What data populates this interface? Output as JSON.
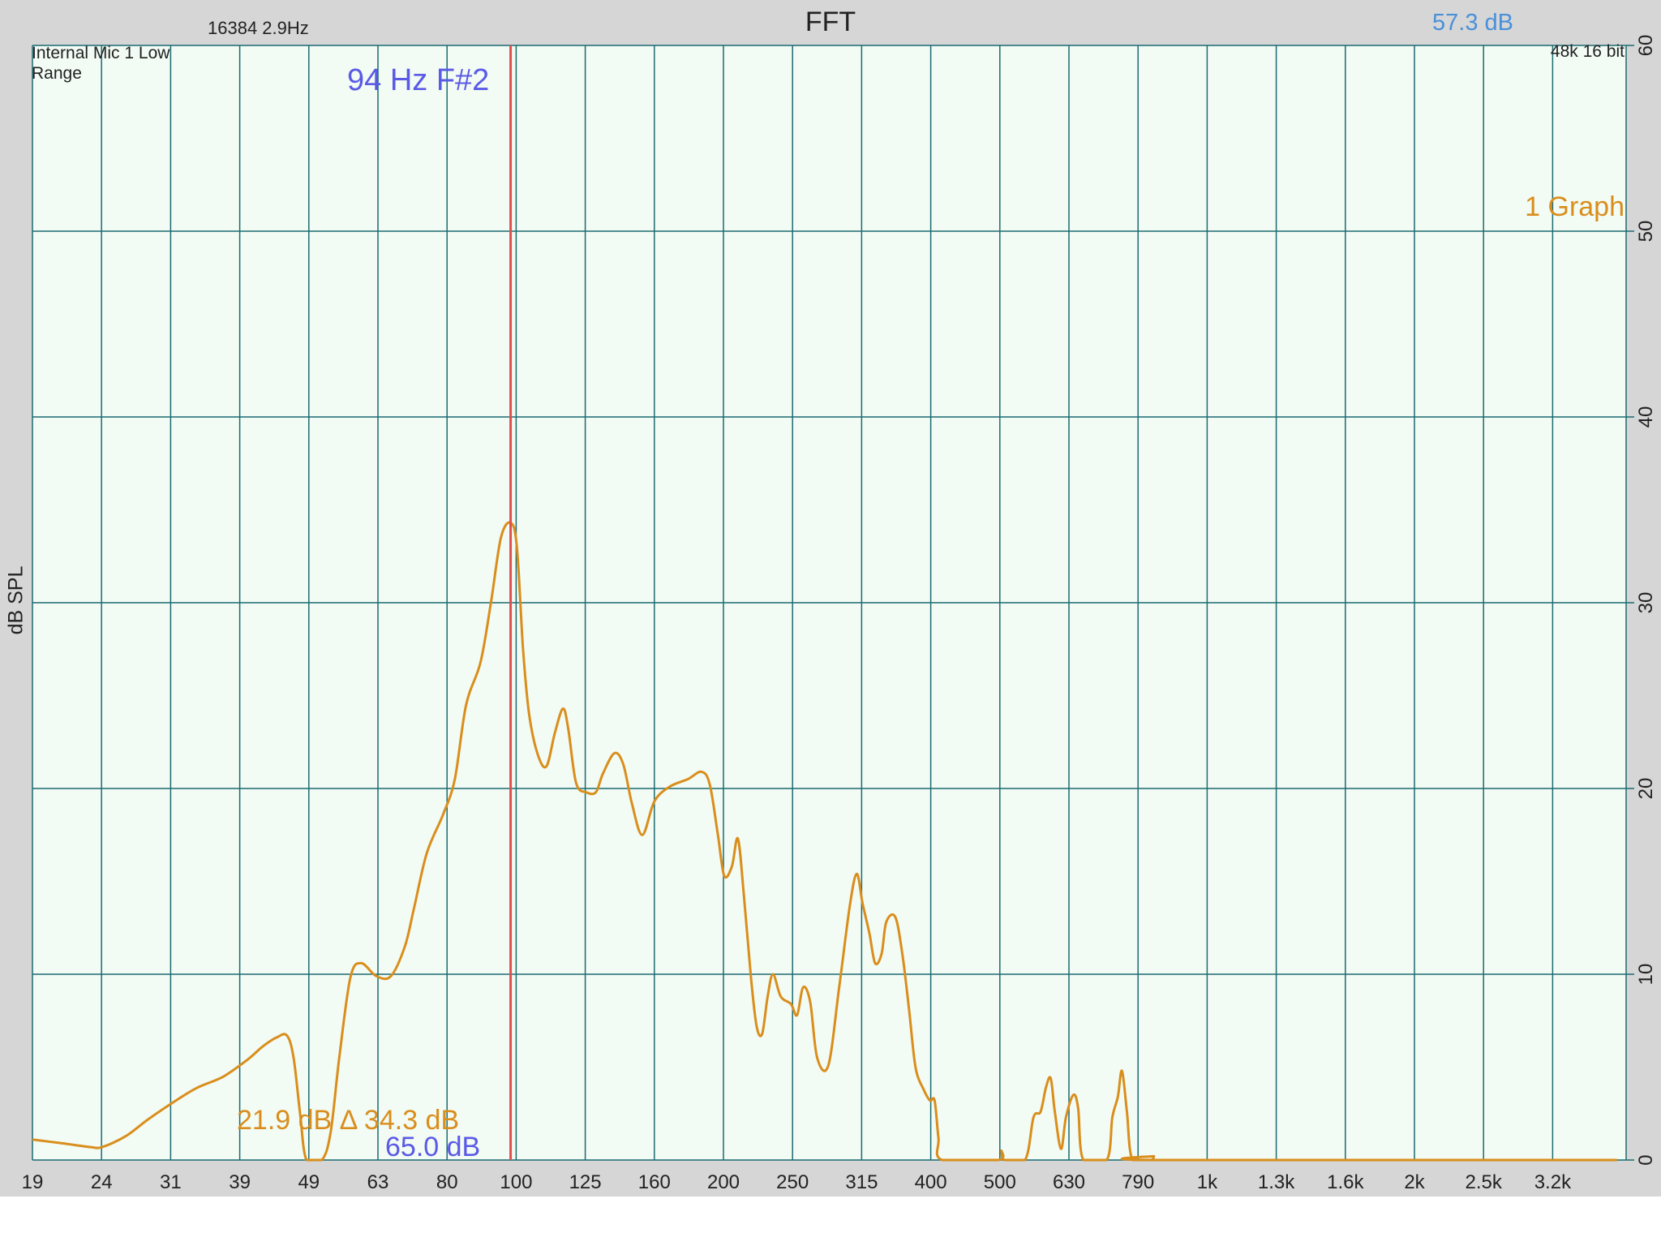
{
  "header": {
    "title": "FFT",
    "fft_info": "16384  2.9Hz",
    "level_readout": "57.3 dB"
  },
  "overlay": {
    "input_label": "Internal Mic 1 Low Range",
    "format_label": "48k 16 bit",
    "graph_label": "1 Graph",
    "marker_note": "94 Hz F#2",
    "marker_level": "21.9 dB Δ 34.3 dB",
    "marker_ref": "65.0 dB"
  },
  "colors": {
    "frame": "#d6d6d6",
    "plot_background": "#f2fbf4",
    "gridline": "#1b6b72",
    "curve": "#d98e1c",
    "marker": "#e05050",
    "note_text": "#5a5ae6",
    "level_text": "#4a90d9"
  },
  "chart_data": {
    "type": "line",
    "title": "FFT",
    "xlabel": "",
    "ylabel": "dB SPL",
    "x_scale": "log",
    "x_ticks": [
      "19",
      "24",
      "31",
      "39",
      "49",
      "63",
      "80",
      "100",
      "125",
      "160",
      "200",
      "250",
      "315",
      "400",
      "500",
      "630",
      "790",
      "1k",
      "1.3k",
      "1.6k",
      "2k",
      "2.5k",
      "3.2k"
    ],
    "y_ticks": [
      "0",
      "10",
      "20",
      "30",
      "40",
      "50",
      "60"
    ],
    "ylim": [
      0,
      60
    ],
    "grid": true,
    "marker_frequency_hz": 94,
    "series": [
      {
        "name": "1 Graph",
        "points": [
          [
            19,
            1.1
          ],
          [
            21,
            0.9
          ],
          [
            23,
            0.7
          ],
          [
            24,
            0.7
          ],
          [
            26,
            1.3
          ],
          [
            28,
            2.2
          ],
          [
            31,
            3.3
          ],
          [
            33,
            3.9
          ],
          [
            36,
            4.5
          ],
          [
            39,
            5.4
          ],
          [
            41,
            6.1
          ],
          [
            43,
            6.6
          ],
          [
            44.5,
            6.7
          ],
          [
            45.5,
            5.5
          ],
          [
            46.5,
            2.5
          ],
          [
            47.5,
            0
          ],
          [
            50,
            0
          ],
          [
            51.5,
            1.5
          ],
          [
            53,
            5.5
          ],
          [
            55,
            9.8
          ],
          [
            57,
            10.6
          ],
          [
            60,
            9.9
          ],
          [
            63,
            9.9
          ],
          [
            66,
            11.5
          ],
          [
            68,
            13.5
          ],
          [
            71,
            16.5
          ],
          [
            75,
            18.6
          ],
          [
            78,
            20.5
          ],
          [
            81,
            24.5
          ],
          [
            85,
            26.8
          ],
          [
            88,
            30.0
          ],
          [
            91,
            33.5
          ],
          [
            94,
            34.3
          ],
          [
            96,
            33.0
          ],
          [
            98,
            27.5
          ],
          [
            100,
            24.0
          ],
          [
            103,
            21.8
          ],
          [
            106,
            21.2
          ],
          [
            109,
            23.0
          ],
          [
            112,
            24.3
          ],
          [
            114,
            23.2
          ],
          [
            117,
            20.3
          ],
          [
            121,
            19.8
          ],
          [
            125,
            19.8
          ],
          [
            128,
            20.8
          ],
          [
            133,
            21.9
          ],
          [
            137,
            21.3
          ],
          [
            141,
            19.2
          ],
          [
            146,
            17.5
          ],
          [
            152,
            19.3
          ],
          [
            160,
            20.1
          ],
          [
            170,
            20.5
          ],
          [
            178,
            20.9
          ],
          [
            183,
            20.2
          ],
          [
            188,
            17.5
          ],
          [
            192,
            15.3
          ],
          [
            197,
            15.8
          ],
          [
            201,
            17.3
          ],
          [
            205,
            14.3
          ],
          [
            210,
            9.8
          ],
          [
            214,
            7.2
          ],
          [
            218,
            6.8
          ],
          [
            222,
            8.8
          ],
          [
            226,
            10.0
          ],
          [
            232,
            8.8
          ],
          [
            240,
            8.4
          ],
          [
            245,
            7.8
          ],
          [
            250,
            9.3
          ],
          [
            256,
            8.5
          ],
          [
            262,
            5.5
          ],
          [
            272,
            5.1
          ],
          [
            282,
            9.3
          ],
          [
            292,
            13.6
          ],
          [
            299,
            15.4
          ],
          [
            305,
            13.8
          ],
          [
            312,
            12.2
          ],
          [
            318,
            10.6
          ],
          [
            325,
            11.1
          ],
          [
            330,
            12.8
          ],
          [
            340,
            13.1
          ],
          [
            348,
            11.2
          ],
          [
            356,
            8.2
          ],
          [
            364,
            5.0
          ],
          [
            374,
            3.8
          ],
          [
            382,
            3.2
          ],
          [
            388,
            3.2
          ],
          [
            393,
            1.2
          ],
          [
            398,
            0
          ],
          [
            480,
            0
          ],
          [
            485,
            0.5
          ],
          [
            490,
            0
          ],
          [
            525,
            0
          ],
          [
            540,
            2.3
          ],
          [
            553,
            2.6
          ],
          [
            563,
            3.9
          ],
          [
            572,
            4.4
          ],
          [
            580,
            2.6
          ],
          [
            592,
            0.6
          ],
          [
            602,
            2.3
          ],
          [
            617,
            3.5
          ],
          [
            627,
            2.8
          ],
          [
            638,
            0
          ],
          [
            690,
            0
          ],
          [
            703,
            2.3
          ],
          [
            716,
            3.4
          ],
          [
            726,
            4.8
          ],
          [
            738,
            2.6
          ],
          [
            752,
            0
          ],
          [
            800,
            0
          ],
          [
            808,
            0.2
          ],
          [
            815,
            0
          ],
          [
            3800,
            0
          ]
        ]
      }
    ]
  }
}
